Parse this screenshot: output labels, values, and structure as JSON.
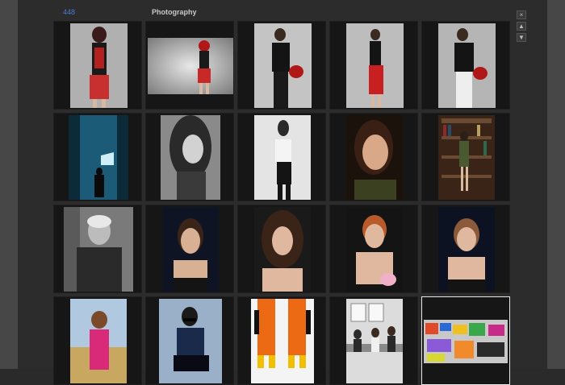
{
  "header": {
    "count": "448",
    "title": "Photography"
  },
  "controls": {
    "close_icon": "×",
    "up_icon": "▲",
    "down_icon": "▼"
  },
  "colors": {
    "accent": "#4a7bd8",
    "cell_bg": "#161616",
    "selected_border": "#e6e6e6"
  },
  "thumbnails": [
    {
      "icon": "photo-woman-red-helmet"
    },
    {
      "icon": "photo-woman-red-helmet-landscape"
    },
    {
      "icon": "photo-woman-black-outfit-helmet"
    },
    {
      "icon": "photo-woman-red-dress"
    },
    {
      "icon": "photo-woman-white-pants-helmet"
    },
    {
      "icon": "photo-man-blue-light"
    },
    {
      "icon": "photo-woman-bw-portrait"
    },
    {
      "icon": "photo-woman-suspenders"
    },
    {
      "icon": "photo-woman-closeup"
    },
    {
      "icon": "photo-woman-bookshelf"
    },
    {
      "icon": "photo-man-bw-portrait"
    },
    {
      "icon": "photo-woman-portrait-1"
    },
    {
      "icon": "photo-woman-portrait-2"
    },
    {
      "icon": "photo-woman-redhead"
    },
    {
      "icon": "photo-woman-portrait-3"
    },
    {
      "icon": "photo-woman-pink-field"
    },
    {
      "icon": "photo-man-sunglasses"
    },
    {
      "icon": "photo-orange-overalls"
    },
    {
      "icon": "photo-office-scene"
    },
    {
      "icon": "photo-colorful-collage"
    }
  ]
}
